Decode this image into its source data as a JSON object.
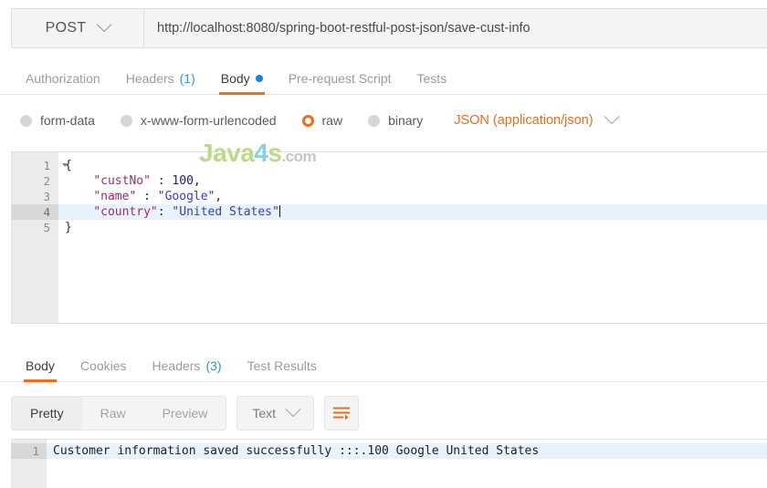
{
  "request": {
    "method": "POST",
    "method_caret_icon": "chevron-down-icon",
    "url": "http://localhost:8080/spring-boot-restful-post-json/save-cust-info",
    "url_placeholder": "Enter request URL",
    "tabs": [
      {
        "label": "Authorization",
        "active": false,
        "badge": ""
      },
      {
        "label": "Headers",
        "active": false,
        "badge": "(1)"
      },
      {
        "label": "Body",
        "active": true,
        "badge": ""
      },
      {
        "label": "Pre-request Script",
        "active": false,
        "badge": ""
      },
      {
        "label": "Tests",
        "active": false,
        "badge": ""
      }
    ]
  },
  "body_type": {
    "options": [
      {
        "label": "form-data",
        "selected": false
      },
      {
        "label": "x-www-form-urlencoded",
        "selected": false
      },
      {
        "label": "raw",
        "selected": true
      },
      {
        "label": "binary",
        "selected": false
      }
    ],
    "content_type": "JSON (application/json)",
    "content_type_caret_icon": "chevron-down-icon"
  },
  "editor": {
    "lines": [
      {
        "num": "1",
        "fold": true,
        "active": false,
        "text": "{"
      },
      {
        "num": "2",
        "fold": false,
        "active": false,
        "text": "    \"custNo\" : 100,"
      },
      {
        "num": "3",
        "fold": false,
        "active": false,
        "text": "    \"name\" : \"Google\","
      },
      {
        "num": "4",
        "fold": false,
        "active": true,
        "text": "    \"country\": \"United States\""
      },
      {
        "num": "5",
        "fold": false,
        "active": false,
        "text": "}"
      }
    ]
  },
  "watermark": {
    "part1": "Java",
    "part2": "4",
    "part3": "s",
    "part4": ".com"
  },
  "response": {
    "tabs": [
      {
        "label": "Body",
        "active": true,
        "badge": ""
      },
      {
        "label": "Cookies",
        "active": false,
        "badge": ""
      },
      {
        "label": "Headers",
        "active": false,
        "badge": "(3)"
      },
      {
        "label": "Test Results",
        "active": false,
        "badge": ""
      }
    ],
    "view_modes": [
      {
        "label": "Pretty",
        "active": true
      },
      {
        "label": "Raw",
        "active": false
      },
      {
        "label": "Preview",
        "active": false
      }
    ],
    "format": "Text",
    "format_caret_icon": "chevron-down-icon",
    "wrap_icon": "word-wrap-icon",
    "lines": [
      {
        "num": "1",
        "text": "Customer information saved successfully :::.100 Google United States"
      }
    ]
  },
  "colors": {
    "accent_orange": "#ef6c1a",
    "link_blue": "#2f93e0",
    "dot_blue": "#1a82e2",
    "active_line": "#e8f2fd",
    "gutter": "#ebebeb",
    "json_key": "#9b2d6f",
    "json_string": "#2f3fd0",
    "json_number": "#1a1a8c"
  }
}
